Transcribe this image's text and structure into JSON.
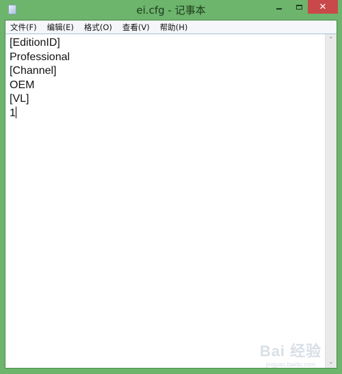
{
  "window": {
    "title": "ei.cfg - 记事本",
    "icon": "notepad-icon",
    "controls": {
      "minimize": "minimize",
      "maximize": "maximize",
      "close": "✕"
    }
  },
  "menubar": {
    "items": [
      {
        "label": "文件(F)"
      },
      {
        "label": "编辑(E)"
      },
      {
        "label": "格式(O)"
      },
      {
        "label": "查看(V)"
      },
      {
        "label": "帮助(H)"
      }
    ]
  },
  "editor": {
    "lines": [
      "[EditionID]",
      "Professional",
      "[Channel]",
      "OEM",
      "[VL]",
      "1"
    ]
  },
  "scrollbar": {
    "up": "⌃",
    "down": "⌄"
  },
  "watermark": {
    "logo": "Bai 经验",
    "url": "jingyan.baidu.com"
  }
}
